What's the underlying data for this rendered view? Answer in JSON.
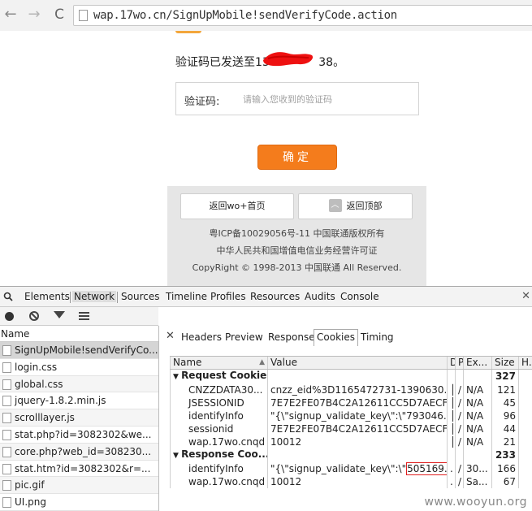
{
  "browser": {
    "url": "wap.17wo.cn/SignUpMobile!sendVerifyCode.action",
    "back_icon": "←",
    "forward_icon": "→",
    "reload_icon": "C"
  },
  "page": {
    "sent_message": "验证码已发送至13　　　　 38。",
    "code_label": "验证码:",
    "code_placeholder": "请输入您收到的验证码",
    "confirm_label": "确定",
    "back_home_label": "返回wo+首页",
    "back_top_label": "返回顶部",
    "footer_line1": "粤ICP备10029056号-11 中国联通版权所有",
    "footer_line2": "中华人民共和国增值电信业务经营许可证",
    "footer_line3": "CopyRight © 1998-2013 中国联通 All Reserved."
  },
  "devtools": {
    "tabs": [
      "Elements",
      "Network",
      "Sources",
      "Timeline",
      "Profiles",
      "Resources",
      "Audits",
      "Console"
    ],
    "active_tab": "Network",
    "requests_header": "Name",
    "requests": [
      "SignUpMobile!sendVerifyCo...",
      "login.css",
      "global.css",
      "jquery-1.8.2.min.js",
      "scrolllayer.js",
      "stat.php?id=3082302&we...",
      "core.php?web_id=308230...",
      "stat.htm?id=3082302&r=...",
      "pic.gif",
      "UI.png"
    ],
    "detail_tabs": [
      "Headers",
      "Preview",
      "Response",
      "Cookies",
      "Timing"
    ],
    "active_detail_tab": "Cookies",
    "cookie_columns": [
      "Name",
      "Value",
      "D",
      "P",
      "Ex...",
      "Size",
      "H..."
    ],
    "request_cookies_label": "Request Cookies",
    "request_cookies_total": "327",
    "request_cookies": [
      {
        "name": "CNZZDATA30...",
        "value": "cnzz_eid%3D1165472731-1390630...",
        "d": "│",
        "p": "/",
        "ex": "N/A",
        "size": "121"
      },
      {
        "name": "JSESSIONID",
        "value": "7E7E2FE07B4C2A12611CC5D7AECF...",
        "d": "│",
        "p": "/",
        "ex": "N/A",
        "size": "45"
      },
      {
        "name": "identifyInfo",
        "value": "\"{\\\"signup_validate_key\\\":\\\"793046...",
        "d": "│",
        "p": "/",
        "ex": "N/A",
        "size": "96"
      },
      {
        "name": "sessionid",
        "value": "7E7E2FE07B4C2A12611CC5D7AECF...",
        "d": "│",
        "p": "/",
        "ex": "N/A",
        "size": "44"
      },
      {
        "name": "wap.17wo.cnqd",
        "value": "10012",
        "d": "│",
        "p": "/",
        "ex": "N/A",
        "size": "21"
      }
    ],
    "response_cookies_label": "Response Coo...",
    "response_cookies_total": "233",
    "response_cookies": [
      {
        "name": "identifyInfo",
        "value_prefix": "\"{\\\"signup_validate_key\\\":\\\"",
        "value_highlight": "505169...",
        "d": ".",
        "p": "/",
        "ex": "30...",
        "size": "166"
      },
      {
        "name": "wap.17wo.cnqd",
        "value_prefix": "10012",
        "value_highlight": "",
        "d": ".",
        "p": "/",
        "ex": "Sa...",
        "size": "67"
      }
    ]
  },
  "watermark": "www.wooyun.org",
  "colors": {
    "confirm_button": "#f47c1c",
    "footer_panel": "#e6e6e6",
    "redaction": "#ee1111",
    "highlight_border": "#e02020"
  }
}
